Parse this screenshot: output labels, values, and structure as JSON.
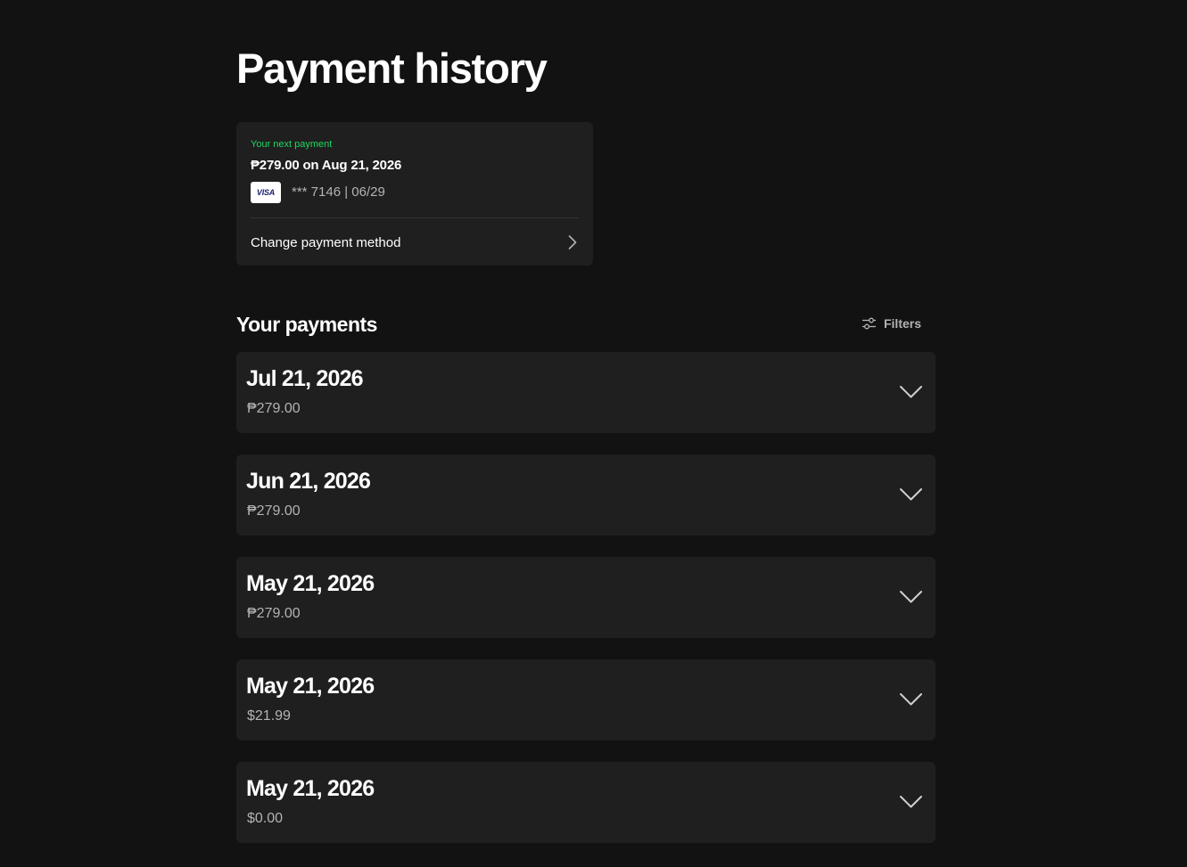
{
  "page": {
    "title": "Payment history"
  },
  "next_payment": {
    "label": "Your next payment",
    "amount_text": "₱279.00 on Aug 21, 2026",
    "card_brand": "VISA",
    "card_info": "*** 7146 | 06/29",
    "change_method_label": "Change payment method",
    "accent_color": "#1ed760"
  },
  "payments": {
    "title": "Your payments",
    "filters_label": "Filters",
    "items": [
      {
        "date": "Jul 21, 2026",
        "amount": "₱279.00"
      },
      {
        "date": "Jun 21, 2026",
        "amount": "₱279.00"
      },
      {
        "date": "May 21, 2026",
        "amount": "₱279.00"
      },
      {
        "date": "May 21, 2026",
        "amount": "$21.99"
      },
      {
        "date": "May 21, 2026",
        "amount": "$0.00"
      }
    ]
  },
  "icons": {
    "visa": "visa-logo-icon",
    "chevron_right": "chevron-right-icon",
    "filters": "sliders-icon",
    "expand": "chevron-down-icon"
  }
}
